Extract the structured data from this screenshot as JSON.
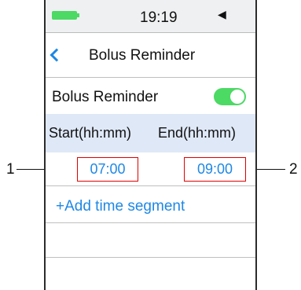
{
  "status_bar": {
    "time": "19:19",
    "battery_icon": "battery-full-icon",
    "sound_icon": "mute-icon",
    "accent_color": "#4cd964"
  },
  "header": {
    "back_icon": "chevron-left-icon",
    "title": "Bolus Reminder"
  },
  "toggle_row": {
    "label": "Bolus Reminder",
    "enabled": true
  },
  "columns": {
    "start": "Start(hh:mm)",
    "end": "End(hh:mm)"
  },
  "segment": {
    "start": "07:00",
    "end": "09:00"
  },
  "add_segment": "+Add time segment",
  "callouts": [
    "1",
    "2"
  ],
  "colors": {
    "link_blue": "#1e88e5",
    "highlight_band": "#dfe8f7",
    "callout_red": "#e00000"
  }
}
